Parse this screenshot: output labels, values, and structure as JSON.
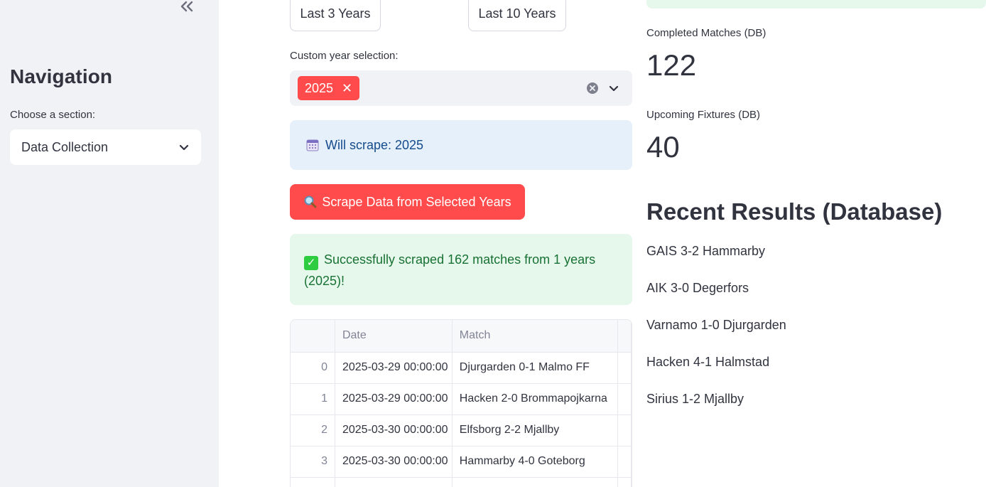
{
  "sidebar": {
    "collapse_icon": "double-chevron-left-icon",
    "title": "Navigation",
    "section_label": "Choose a section:",
    "section_value": "Data Collection"
  },
  "year_buttons": {
    "last3": "Last 3 Years",
    "last10": "Last 10 Years"
  },
  "custom_years": {
    "label": "Custom year selection:",
    "selected": [
      "2025"
    ]
  },
  "info": {
    "icon": "calendar-icon",
    "text": "Will scrape: 2025"
  },
  "scrape_button": {
    "icon": "magnifier-icon",
    "label": "Scrape Data from Selected Years"
  },
  "success": {
    "icon": "check-icon",
    "text": "Successfully scraped 162 matches from 1 years (2025)!"
  },
  "table": {
    "columns": [
      "",
      "Date",
      "Match"
    ],
    "rows": [
      {
        "idx": "0",
        "date": "2025-03-29 00:00:00",
        "match": "Djurgarden 0-1 Malmo FF"
      },
      {
        "idx": "1",
        "date": "2025-03-29 00:00:00",
        "match": "Hacken 2-0 Brommapojkarna"
      },
      {
        "idx": "2",
        "date": "2025-03-30 00:00:00",
        "match": "Elfsborg 2-2 Mjallby"
      },
      {
        "idx": "3",
        "date": "2025-03-30 00:00:00",
        "match": "Hammarby 4-0 Goteborg"
      }
    ]
  },
  "metrics": {
    "completed_label": "Completed Matches (DB)",
    "completed_value": "122",
    "upcoming_label": "Upcoming Fixtures (DB)",
    "upcoming_value": "40"
  },
  "recent": {
    "title": "Recent Results (Database)",
    "items": [
      "GAIS 3-2 Hammarby",
      "AIK 3-0 Degerfors",
      "Varnamo 1-0 Djurgarden",
      "Hacken 4-1 Halmstad",
      "Sirius 1-2 Mjallby"
    ]
  },
  "colors": {
    "primary": "#ff4b4b",
    "info_bg": "#e6f0fb",
    "success_bg": "#e6f7ec",
    "sidebar_bg": "#f0f2f6"
  }
}
